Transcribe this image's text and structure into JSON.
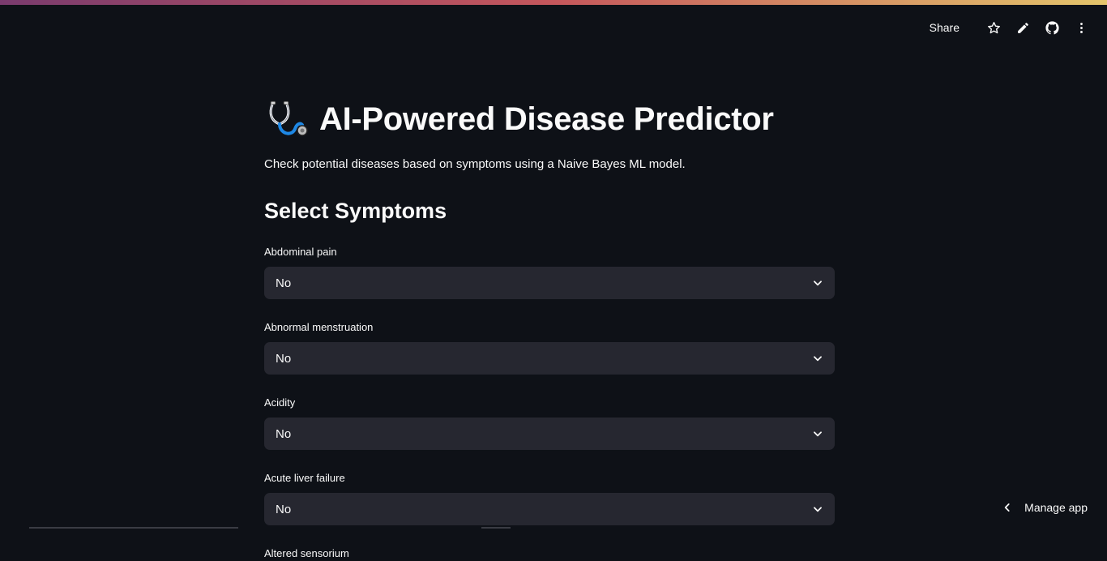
{
  "app": {
    "title": "AI-Powered Disease Predictor",
    "subtitle": "Check potential diseases based on symptoms using a Naive Bayes ML model.",
    "title_icon": "stethoscope-icon"
  },
  "toolbar": {
    "share_label": "Share",
    "icons": [
      "star-icon",
      "edit-pencil-icon",
      "github-icon",
      "more-vertical-icon"
    ]
  },
  "section": {
    "title": "Select Symptoms"
  },
  "symptoms": [
    {
      "label": "Abdominal pain",
      "value": "No"
    },
    {
      "label": "Abnormal menstruation",
      "value": "No"
    },
    {
      "label": "Acidity",
      "value": "No"
    },
    {
      "label": "Acute liver failure",
      "value": "No"
    },
    {
      "label": "Altered sensorium",
      "value": ""
    }
  ],
  "footer": {
    "manage_app_label": "Manage app"
  },
  "colors": {
    "background": "#0e1117",
    "select_bg": "#262730",
    "text": "#fafafa"
  }
}
